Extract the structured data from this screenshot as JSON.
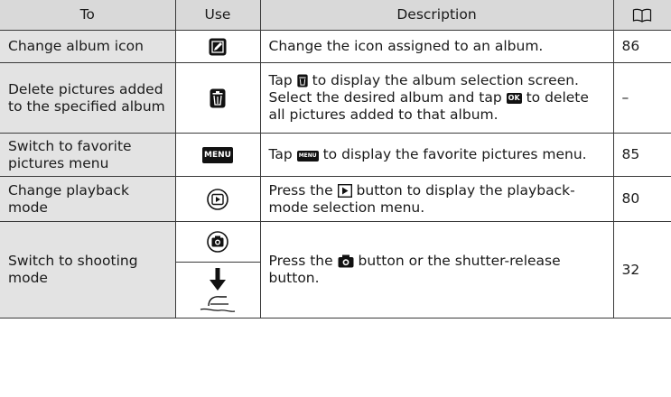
{
  "header": {
    "to": "To",
    "use": "Use",
    "description": "Description",
    "page_icon": "book-icon"
  },
  "rows": [
    {
      "to": "Change album icon",
      "use_icon": "edit-icon",
      "description": "Change the icon assigned to an album.",
      "page": "86"
    },
    {
      "to": "Delete pictures added to the specified album",
      "use_icon": "trash-icon",
      "description_parts": [
        "Tap",
        "to display the album selection screen. Select the desired album and tap",
        "to delete all pictures added to that album."
      ],
      "ok_label": "OK",
      "page": "–"
    },
    {
      "to": "Switch to favorite pictures menu",
      "use_icon": "menu-icon",
      "menu_label": "MENU",
      "description_parts": [
        "Tap",
        "to display the favorite pictures menu."
      ],
      "page": "85"
    },
    {
      "to": "Change playback mode",
      "use_icon": "playback-button-icon",
      "description_parts": [
        "Press the",
        "button to display the playback-mode selection menu."
      ],
      "page": "80"
    },
    {
      "to": "Switch to shooting mode",
      "use_icons": [
        "shooting-button-icon",
        "shutter-release-icon"
      ],
      "description_parts": [
        "Press the",
        "button or the shutter-release button."
      ],
      "page": "32"
    }
  ]
}
